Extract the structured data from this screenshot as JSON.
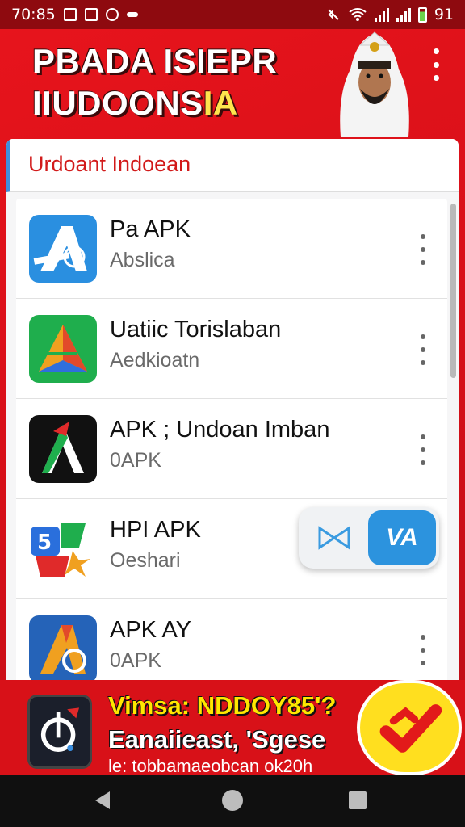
{
  "status_bar": {
    "time": "70:85",
    "battery_text": "91"
  },
  "header": {
    "title_line1": "PBADA ISIEPR",
    "title_line2_main": "IIUDOONS",
    "title_line2_accent": "IA",
    "avatar_icon": "person-avatar-icon",
    "menu_icon": "overflow-menu-icon"
  },
  "card": {
    "tab_label": "Urdoant Indoean",
    "accent_color": "#3f8fdc"
  },
  "apps": [
    {
      "name": "Pa APK",
      "subtitle": "Abslica",
      "icon": "app-store-a-icon"
    },
    {
      "name": "Uatiic Torislaban",
      "subtitle": "Aedkioatn",
      "icon": "triangle-app-icon"
    },
    {
      "name": "APK ; Undoan Imban",
      "subtitle": "0APK",
      "icon": "black-a-app-icon"
    },
    {
      "name": "HPI APK",
      "subtitle": "Oeshari",
      "icon": "number-5-app-icon"
    },
    {
      "name": "APK AY",
      "subtitle": "0APK",
      "icon": "blue-a-app-icon"
    }
  ],
  "toggle": {
    "right_label": "VA",
    "left_icon": "bowtie-icon"
  },
  "banner": {
    "line1": "Vimsa: NDDOY85'?",
    "line2": "Eanaiieast, 'Sgese",
    "line3": "le: tobbamaeobcan ok20h",
    "app_icon": "dark-app-icon",
    "badge_icon": "checkmark-badge-icon"
  },
  "colors": {
    "brand_red": "#d40f18",
    "accent_yellow": "#ffe600",
    "toggle_blue": "#2c93de"
  }
}
